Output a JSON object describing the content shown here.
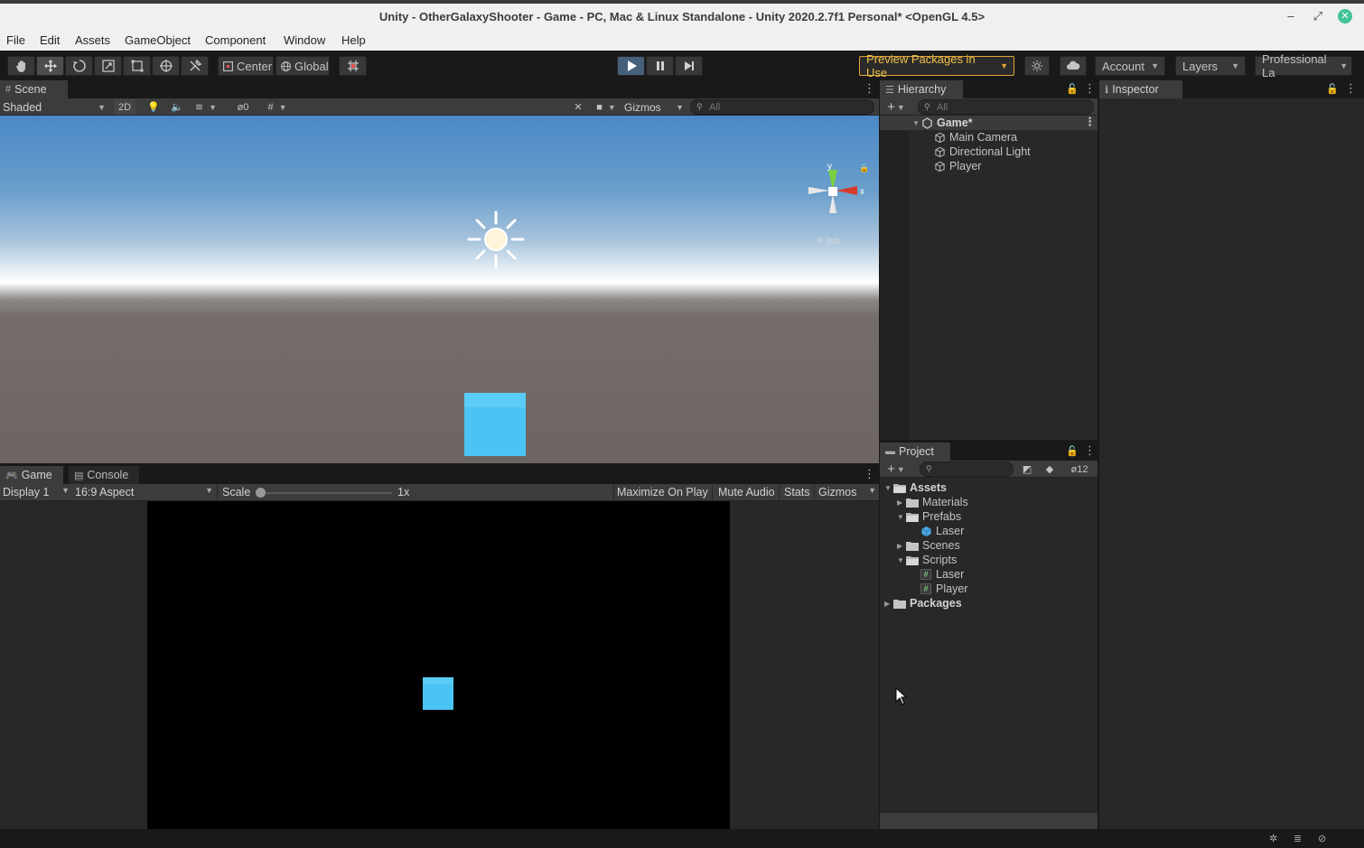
{
  "window": {
    "title": "Unity - OtherGalaxyShooter - Game - PC, Mac & Linux Standalone - Unity 2020.2.7f1 Personal* <OpenGL 4.5>"
  },
  "menu": [
    "File",
    "Edit",
    "Assets",
    "GameObject",
    "Component",
    "Window",
    "Help"
  ],
  "toolbar": {
    "pivot_label": "Center",
    "space_label": "Global",
    "preview_packages": "Preview Packages in Use",
    "account": "Account",
    "layers": "Layers",
    "layout": "Professional La"
  },
  "scene": {
    "tab": "Scene",
    "draw_mode": "Shaded",
    "mode_2d": "2D",
    "hidden_count": "0",
    "gizmos": "Gizmos",
    "search_placeholder": "All",
    "axis_y": "y",
    "axis_x": "x",
    "projection": "Iso"
  },
  "game": {
    "tab": "Game",
    "console_tab": "Console",
    "display": "Display 1",
    "aspect": "16:9 Aspect",
    "scale_label": "Scale",
    "scale_value": "1x",
    "maximize": "Maximize On Play",
    "mute": "Mute Audio",
    "stats": "Stats",
    "gizmos": "Gizmos"
  },
  "hierarchy": {
    "tab": "Hierarchy",
    "search_placeholder": "All",
    "scene_name": "Game*",
    "objects": [
      "Main Camera",
      "Directional Light",
      "Player"
    ]
  },
  "project": {
    "tab": "Project",
    "hidden_count": "12",
    "tree": {
      "assets": "Assets",
      "materials": "Materials",
      "prefabs": "Prefabs",
      "prefab_laser": "Laser",
      "scenes": "Scenes",
      "scripts": "Scripts",
      "script_laser": "Laser",
      "script_player": "Player",
      "packages": "Packages"
    }
  },
  "inspector": {
    "tab": "Inspector"
  },
  "colors": {
    "accent_play": "#46607c",
    "preview_warn": "#e0a43a",
    "cube": "#4bc4f4"
  }
}
